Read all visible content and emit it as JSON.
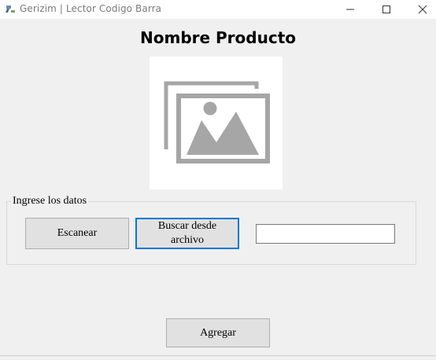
{
  "window": {
    "title": "Gerizim | Lector Codigo Barra",
    "app_icon": "barcode-scanner-icon",
    "controls": [
      "minimize-icon",
      "maximize-icon",
      "close-icon"
    ]
  },
  "product": {
    "name": "Nombre Producto",
    "image_icon": "image-placeholder-icon"
  },
  "group": {
    "legend": "Ingrese los datos",
    "scan_label": "Escanear",
    "browse_label": "Buscar desde archivo",
    "code_value": ""
  },
  "actions": {
    "add_label": "Agregar"
  },
  "colors": {
    "background": "#f0f0f0",
    "focus_border": "#0078d7",
    "button_face": "#e1e1e1",
    "placeholder_icon": "#a6a6a6"
  }
}
